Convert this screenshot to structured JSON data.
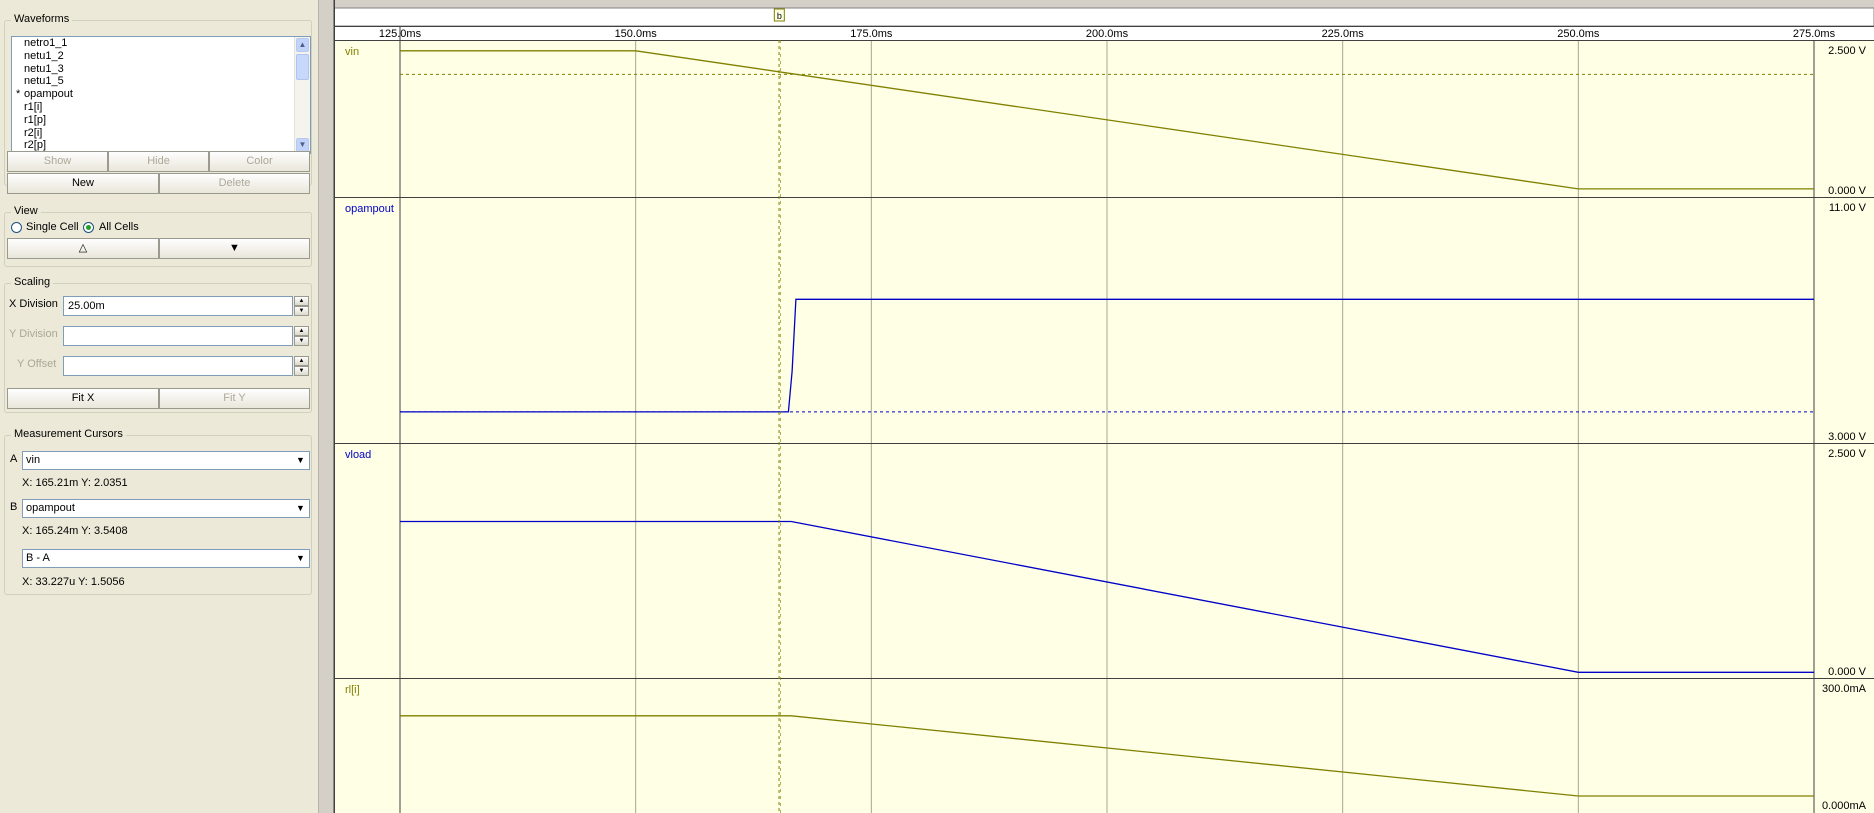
{
  "waveforms": {
    "title": "Waveforms",
    "items": [
      {
        "label": "netro1_1",
        "mark": ""
      },
      {
        "label": "netu1_2",
        "mark": ""
      },
      {
        "label": "netu1_3",
        "mark": ""
      },
      {
        "label": "netu1_5",
        "mark": ""
      },
      {
        "label": "opampout",
        "mark": "*"
      },
      {
        "label": "r1[i]",
        "mark": ""
      },
      {
        "label": "r1[p]",
        "mark": ""
      },
      {
        "label": "r2[i]",
        "mark": ""
      },
      {
        "label": "r2[p]",
        "mark": ""
      }
    ],
    "show_label": "Show",
    "hide_label": "Hide",
    "color_label": "Color",
    "new_label": "New",
    "delete_label": "Delete"
  },
  "view": {
    "title": "View",
    "single_label": "Single Cell",
    "all_label": "All Cells",
    "selected": "all",
    "up_glyph": "△",
    "down_glyph": "▼"
  },
  "scaling": {
    "title": "Scaling",
    "x_label": "X Division",
    "x_value": "25.00m",
    "y_label": "Y Division",
    "y_value": "",
    "offset_label": "Y Offset",
    "offset_value": "",
    "fitx_label": "Fit X",
    "fity_label": "Fit Y"
  },
  "cursors": {
    "title": "Measurement Cursors",
    "a_label": "A",
    "a_signal": "vin",
    "a_readout": "X: 165.21m  Y: 2.0351",
    "b_label": "B",
    "b_signal": "opampout",
    "b_readout": "X: 165.24m  Y: 3.5408",
    "diff_signal": "B - A",
    "diff_readout": "X: 33.227u  Y: 1.5056"
  },
  "plot": {
    "cursor_marker": "b",
    "x_ticks": [
      {
        "t": 125,
        "label": "125.0ms"
      },
      {
        "t": 150,
        "label": "150.0ms"
      },
      {
        "t": 175,
        "label": "175.0ms"
      },
      {
        "t": 200,
        "label": "200.0ms"
      },
      {
        "t": 225,
        "label": "225.0ms"
      },
      {
        "t": 250,
        "label": "250.0ms"
      },
      {
        "t": 275,
        "label": "275.0ms"
      }
    ],
    "cursor_a_x": 165.21,
    "cursor_b_x": 165.24,
    "bg_color": "#ffffe6",
    "grid_color": "#a8a890",
    "frame_color": "#404040",
    "panels": [
      {
        "name": "vin",
        "label": "vin",
        "color": "#808000",
        "ymax_label": "2.500 V",
        "ymin_label": "0.000 V",
        "ymin": 0,
        "ymax": 2.5,
        "cursor_y": 2.0351,
        "data": {
          "x": [
            125,
            150,
            250,
            275
          ],
          "y": [
            2.45,
            2.45,
            0.02,
            0.02
          ]
        }
      },
      {
        "name": "opampout",
        "label": "opampout",
        "color": "#0000c8",
        "ymax_label": "11.00 V",
        "ymin_label": "3.000 V",
        "ymin": 3,
        "ymax": 11,
        "cursor_y": 3.5408,
        "data": {
          "x": [
            125,
            166.2,
            166.6,
            167,
            275
          ],
          "y": [
            3.54,
            3.54,
            5.5,
            9.0,
            9.0
          ]
        }
      },
      {
        "name": "vload",
        "label": "vload",
        "color": "#0000c8",
        "ymax_label": "2.500 V",
        "ymin_label": "0.000 V",
        "ymin": 0,
        "ymax": 2.5,
        "data": {
          "x": [
            125,
            166.5,
            250,
            275
          ],
          "y": [
            2.07,
            2.07,
            0.01,
            0.01
          ]
        }
      },
      {
        "name": "rl-i",
        "label": "rl[i]",
        "color": "#808000",
        "ymax_label": "300.0mA",
        "ymin_label": "0.000mA",
        "ymin": 0,
        "ymax": 300,
        "data": {
          "x": [
            125,
            166.5,
            250,
            275
          ],
          "y": [
            246,
            246,
            3,
            3
          ]
        }
      }
    ]
  }
}
